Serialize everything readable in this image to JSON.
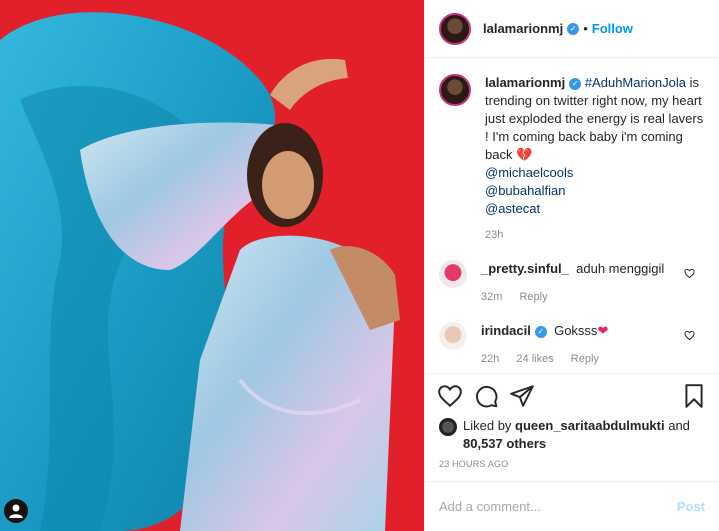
{
  "post": {
    "username": "lalamarionmj",
    "follow_label": "Follow",
    "dot": "•",
    "caption_hashtag": "#AduhMarionJola",
    "caption_text": " is trending on twitter right now, my heart just exploded the energy is real lavers ! I'm coming back baby i'm coming back",
    "caption_emoji": "💔",
    "mentions": [
      "@michaelcools",
      "@bubahalfian",
      "@astecat"
    ],
    "caption_time": "23h"
  },
  "comments": [
    {
      "username": "_pretty.sinful_",
      "text": "aduh menggigil",
      "time": "32m",
      "likes": "",
      "reply": "Reply"
    },
    {
      "username": "irindacil",
      "text": "Goksss",
      "emoji": "❤",
      "time": "22h",
      "likes": "24 likes",
      "reply": "Reply"
    }
  ],
  "likes": {
    "prefix": "Liked by",
    "user": "queen_saritaabdulmukti",
    "and": "and",
    "others": "80,537 others"
  },
  "timestamp": "23 HOURS AGO",
  "add_comment": {
    "placeholder": "Add a comment...",
    "post_label": "Post"
  },
  "colors": {
    "accent": "#0095f6",
    "photo_bg": "#e2202c",
    "fabric": "#1aa3c9"
  }
}
